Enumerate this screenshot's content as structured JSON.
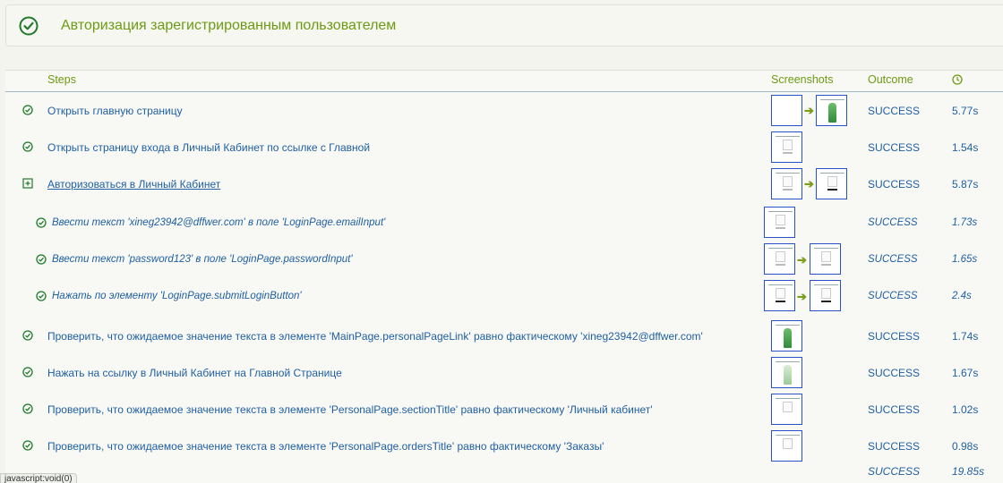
{
  "header": {
    "title": "Авторизация зарегистрированным пользователем"
  },
  "table": {
    "columns": {
      "steps": "Steps",
      "screenshots": "Screenshots",
      "outcome": "Outcome"
    },
    "rows": [
      {
        "label": "Открыть главную страницу",
        "outcome": "SUCCESS",
        "time": "5.77s"
      },
      {
        "label": "Открыть страницу входа в Личный Кабинет по ссылке с Главной",
        "outcome": "SUCCESS",
        "time": "1.54s"
      },
      {
        "label": "Авторизоваться в Личный Кабинет",
        "outcome": "SUCCESS",
        "time": "5.87s"
      },
      {
        "label": "Ввести текст 'xineg23942@dffwer.com' в поле 'LoginPage.emailInput'",
        "outcome": "SUCCESS",
        "time": "1.73s"
      },
      {
        "label": "Ввести текст 'password123' в поле 'LoginPage.passwordInput'",
        "outcome": "SUCCESS",
        "time": "1.65s"
      },
      {
        "label": "Нажать по элементу 'LoginPage.submitLoginButton'",
        "outcome": "SUCCESS",
        "time": "2.4s"
      },
      {
        "label": "Проверить, что ожидаемое значение текста в элементе 'MainPage.personalPageLink' равно фактическому 'xineg23942@dffwer.com'",
        "outcome": "SUCCESS",
        "time": "1.74s"
      },
      {
        "label": "Нажать на ссылку в Личный Кабинет на Главной Странице",
        "outcome": "SUCCESS",
        "time": "1.67s"
      },
      {
        "label": "Проверить, что ожидаемое значение текста в элементе 'PersonalPage.sectionTitle' равно фактическому 'Личный кабинет'",
        "outcome": "SUCCESS",
        "time": "1.02s"
      },
      {
        "label": "Проверить, что ожидаемое значение текста в элементе 'PersonalPage.ordersTitle' равно фактическому 'Заказы'",
        "outcome": "SUCCESS",
        "time": "0.98s"
      }
    ],
    "total": {
      "outcome": "SUCCESS",
      "time": "19.85s"
    }
  },
  "icons": {
    "success": "check-circle-icon",
    "expand": "plus-square-icon",
    "duration": "clock-icon",
    "transition": "arrow-right-icon"
  },
  "colors": {
    "accent_green": "#6d9a13",
    "link_blue": "#1f5fa3",
    "thumb_border": "#2a52c8"
  },
  "statusbar": {
    "text": "javascript:void(0)"
  }
}
